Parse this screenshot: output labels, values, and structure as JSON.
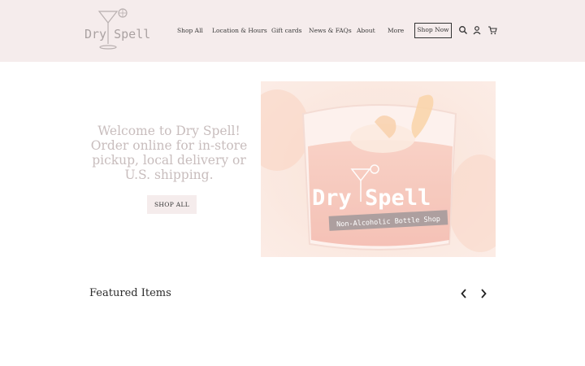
{
  "brand": {
    "logo_text": "Dry Spell",
    "badge_text": "Non-Alcoholic Bottle Shop"
  },
  "nav": {
    "items": [
      {
        "label": "Shop All"
      },
      {
        "label": "Location & Hours"
      },
      {
        "label": "Gift cards"
      },
      {
        "label": "News & FAQs"
      },
      {
        "label": "About"
      },
      {
        "label": "More"
      }
    ],
    "cta_label": "Shop Now",
    "icons": [
      "search-icon",
      "account-icon",
      "cart-icon"
    ]
  },
  "hero": {
    "headline": "Welcome to Dry Spell! Order online for in-store pickup, local delivery or U.S. shipping.",
    "button_label": "SHOP ALL"
  },
  "featured": {
    "title": "Featured Items",
    "icons": [
      "chevron-left-icon",
      "chevron-right-icon"
    ]
  },
  "colors": {
    "header_bg": "#f5ecec",
    "hero_text": "#c8bdbd",
    "button_bg": "#f5ecec"
  }
}
